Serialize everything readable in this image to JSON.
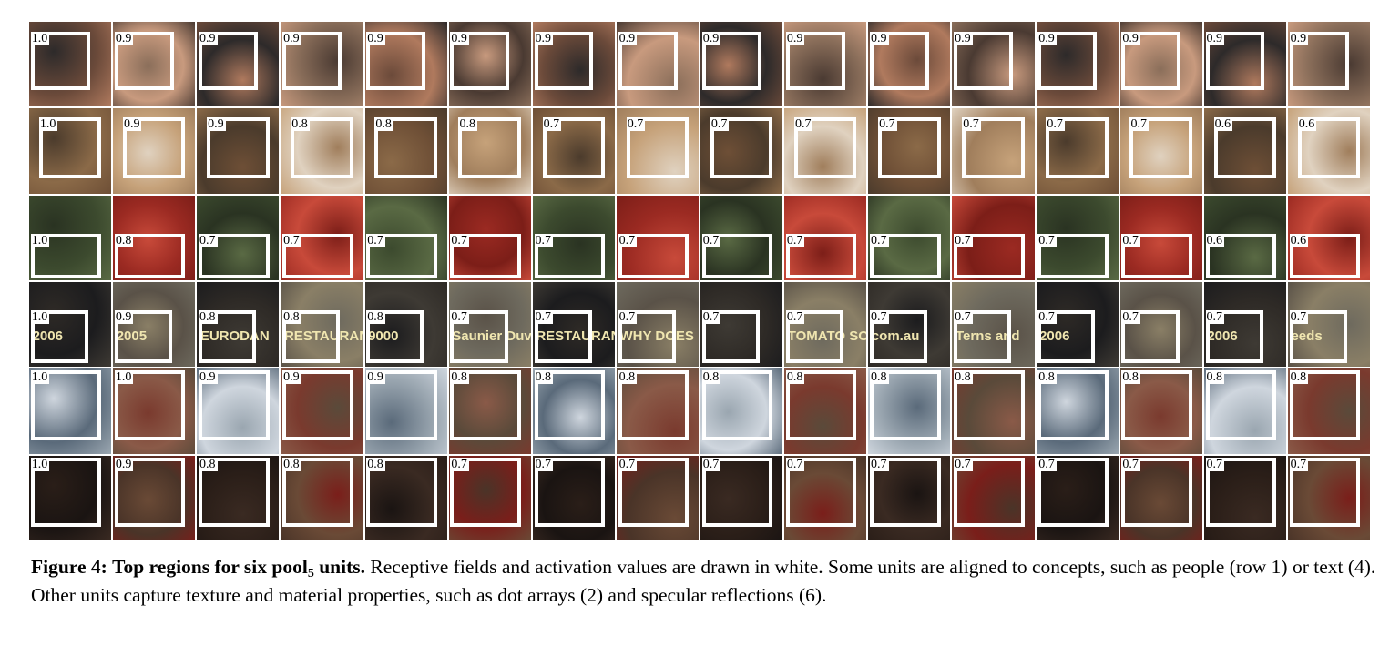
{
  "figure": {
    "rows": [
      {
        "values": [
          "1.0",
          "0.9",
          "0.9",
          "0.9",
          "0.9",
          "0.9",
          "0.9",
          "0.9",
          "0.9",
          "0.9",
          "0.9",
          "0.9",
          "0.9",
          "0.9",
          "0.9",
          "0.9"
        ]
      },
      {
        "values": [
          "1.0",
          "0.9",
          "0.9",
          "0.8",
          "0.8",
          "0.8",
          "0.7",
          "0.7",
          "0.7",
          "0.7",
          "0.7",
          "0.7",
          "0.7",
          "0.7",
          "0.6",
          "0.6"
        ]
      },
      {
        "values": [
          "1.0",
          "0.8",
          "0.7",
          "0.7",
          "0.7",
          "0.7",
          "0.7",
          "0.7",
          "0.7",
          "0.7",
          "0.7",
          "0.7",
          "0.7",
          "0.7",
          "0.6",
          "0.6"
        ]
      },
      {
        "values": [
          "1.0",
          "0.9",
          "0.8",
          "0.8",
          "0.8",
          "0.7",
          "0.7",
          "0.7",
          "0.7",
          "0.7",
          "0.7",
          "0.7",
          "0.7",
          "0.7",
          "0.7",
          "0.7"
        ]
      },
      {
        "values": [
          "1.0",
          "1.0",
          "0.9",
          "0.9",
          "0.9",
          "0.8",
          "0.8",
          "0.8",
          "0.8",
          "0.8",
          "0.8",
          "0.8",
          "0.8",
          "0.8",
          "0.8",
          "0.8"
        ]
      },
      {
        "values": [
          "1.0",
          "0.9",
          "0.8",
          "0.8",
          "0.8",
          "0.7",
          "0.7",
          "0.7",
          "0.7",
          "0.7",
          "0.7",
          "0.7",
          "0.7",
          "0.7",
          "0.7",
          "0.7"
        ]
      }
    ],
    "cell_text": {
      "r3c0": "2006",
      "r3c1": "2005",
      "r3c2": "EURODAN",
      "r3c3": "RESTAURANT",
      "r3c4": "9000",
      "r3c5": "Saunier Duval",
      "r3c6": "RESTAURANT",
      "r3c7": "WHY DOES",
      "r3c9": "TOMATO SOUP",
      "r3c10": "com.au",
      "r3c11": "Terns and",
      "r3c12": "2006",
      "r3c14": "2006",
      "r3c15": "eeds"
    },
    "caption": {
      "label": "Figure 4:",
      "title_pre": "Top regions for six pool",
      "title_sub": "5",
      "title_post": "units.",
      "body": " Receptive fields and activation values are drawn in white. Some units are aligned to concepts, such as people (row 1) or text (4). Other units capture texture and material properties, such as dot arrays (2) and specular reflections (6)."
    }
  }
}
